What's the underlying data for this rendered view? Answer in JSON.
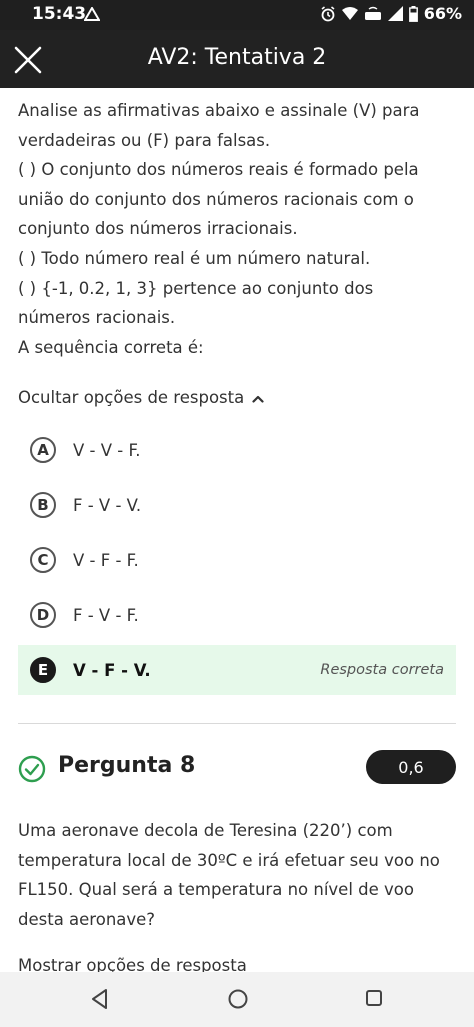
{
  "status_bar": {
    "time": "15:43",
    "battery": "66%",
    "icons": [
      "alarm-icon",
      "wifi-icon",
      "volte-icon",
      "signal-icon",
      "battery-icon"
    ]
  },
  "app_bar": {
    "title": "AV2: Tentativa 2",
    "close_icon": "close-icon"
  },
  "question": {
    "lines": [
      "Analise as afirmativas abaixo e assinale (V) para",
      "verdadeiras ou (F) para falsas.",
      "( ) O conjunto dos números reais é formado pela",
      "união do conjunto dos números racionais com o",
      "conjunto dos números irracionais.",
      "( ) Todo número real é um número natural.",
      "( ) {-1, 0.2, 1, 3} pertence ao conjunto dos",
      "números racionais.",
      "A sequência correta é:"
    ],
    "toggle_label": "Ocultar opções de resposta",
    "options": [
      {
        "letter": "A",
        "text": "V - V - F."
      },
      {
        "letter": "B",
        "text": "F - V - V."
      },
      {
        "letter": "C",
        "text": "V - F - F."
      },
      {
        "letter": "D",
        "text": "F - V - F."
      },
      {
        "letter": "E",
        "text": "V - F - V."
      }
    ],
    "correct_label": "Resposta correta",
    "correct_color": "#e6f9ea"
  },
  "question8": {
    "title": "Pergunta 8",
    "score": "0,6",
    "status_color": "#2e9e4f",
    "lines": [
      "Uma aeronave decola de Teresina (220’) com",
      "temperatura local de 30ºC e irá efetuar seu voo no",
      "FL150. Qual será a temperatura no nível de voo",
      "desta aeronave?"
    ],
    "peek": "Mostrar opções de resposta"
  },
  "nav_bar": {
    "buttons": [
      "back-icon",
      "home-icon",
      "recents-icon"
    ]
  }
}
